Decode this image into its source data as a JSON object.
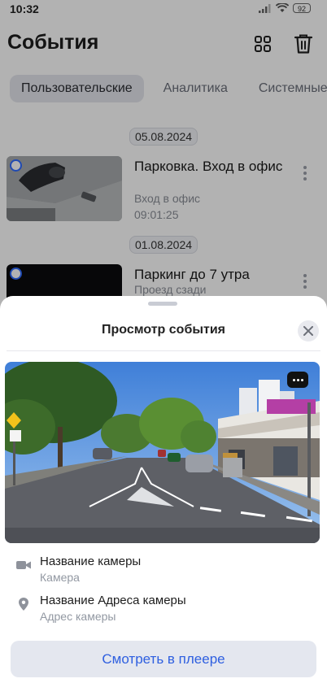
{
  "status": {
    "time": "10:32",
    "battery": "92"
  },
  "header": {
    "title": "События"
  },
  "tabs": [
    {
      "label": "Пользовательские",
      "active": true
    },
    {
      "label": "Аналитика",
      "active": false
    },
    {
      "label": "Системные",
      "active": false
    }
  ],
  "events": [
    {
      "date": "05.08.2024",
      "title": "Парковка. Вход в офис",
      "location": "Вход в офис",
      "time": "09:01:25"
    },
    {
      "date": "01.08.2024",
      "title": "Паркинг до 7 утра",
      "location": "Проезд сзади",
      "time": ""
    }
  ],
  "sheet": {
    "title": "Просмотр события",
    "camera_title": "Название камеры",
    "camera_sub": "Камера",
    "address_title": "Название Адреса камеры",
    "address_sub": "Адрес камеры",
    "player_button": "Смотреть в плеере"
  },
  "icons": {
    "grid": "grid-icon",
    "trash": "trash-icon",
    "close": "close-icon",
    "more": "more-icon",
    "camera": "video-camera-icon",
    "pin": "location-pin-icon"
  },
  "colors": {
    "accent": "#2e5fe0",
    "badge": "#2f6bff"
  }
}
